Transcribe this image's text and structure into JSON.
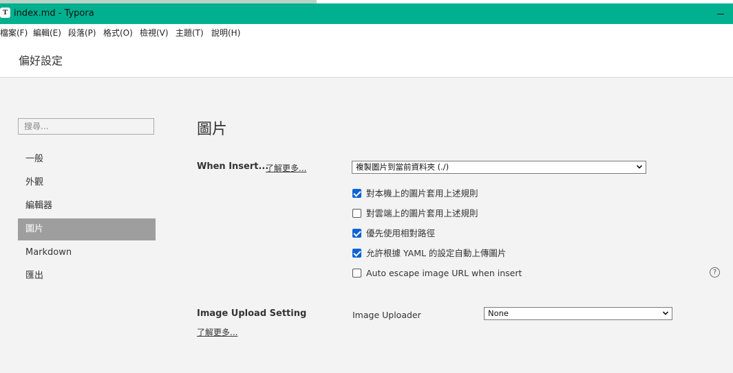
{
  "window": {
    "title": "index.md - Typora",
    "app_icon_letter": "T",
    "titlebar_color": "#00b08f"
  },
  "menu": [
    "檔案(F)",
    "編輯(E)",
    "段落(P)",
    "格式(O)",
    "檢視(V)",
    "主題(T)",
    "說明(H)"
  ],
  "preferences": {
    "header": "偏好設定",
    "search_placeholder": "搜尋...",
    "nav": [
      {
        "label": "一般",
        "active": false
      },
      {
        "label": "外觀",
        "active": false
      },
      {
        "label": "編輯器",
        "active": false
      },
      {
        "label": "圖片",
        "active": true
      },
      {
        "label": "Markdown",
        "active": false
      },
      {
        "label": "匯出",
        "active": false
      }
    ]
  },
  "images_section": {
    "title": "圖片",
    "when_insert": {
      "label": "When Insert...",
      "learn_more": "了解更多...",
      "selected_option": "複製圖片到當前資料夾 (./)"
    },
    "options": [
      {
        "label": "對本機上的圖片套用上述規則",
        "checked": true
      },
      {
        "label": "對雲端上的圖片套用上述規則",
        "checked": false
      },
      {
        "label": "優先使用相對路徑",
        "checked": true
      },
      {
        "label": "允許根據 YAML 的設定自動上傳圖片",
        "checked": true
      },
      {
        "label": "Auto escape image URL when insert",
        "checked": false
      }
    ],
    "help_icon": "?",
    "upload": {
      "label": "Image Upload Setting",
      "learn_more": "了解更多...",
      "uploader_label": "Image Uploader",
      "uploader_value": "None"
    }
  },
  "colors": {
    "accent": "#00b08f",
    "active_nav": "#9e9e9e",
    "checkbox_on": "#0a63d6"
  }
}
